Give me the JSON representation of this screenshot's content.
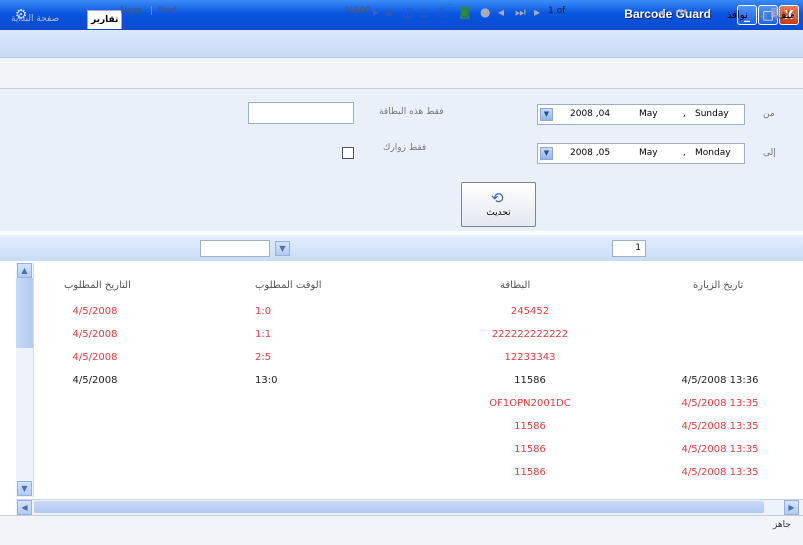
{
  "window": {
    "title": "Barcode Guard",
    "min": "_",
    "max": "□",
    "close": "X"
  },
  "menu": {
    "file": "ملف",
    "windows": "نوافذ"
  },
  "tabs": {
    "reports": "تقارير",
    "home": "صفحة البداية",
    "nav": "◁ ▷ X"
  },
  "filter": {
    "from_label": "من",
    "to_label": "إلى",
    "from_date": {
      "day": "Sunday",
      "month": "May",
      "date": "2008 ,04"
    },
    "to_date": {
      "day": "Monday",
      "month": "May",
      "date": "2008 ,05"
    },
    "card_only_label": "فقط هذه البطاقة",
    "my_visitors_label": "فقط زوارك",
    "card_value": "",
    "refresh_label": "تحديث"
  },
  "toolbar": {
    "find_next": "Next",
    "find": "Find",
    "zoom": "%100",
    "page_of": "1 of",
    "page_num": "1"
  },
  "report": {
    "columns": {
      "visit_date": "تاريخ الزيارة",
      "card": "البطاقة",
      "required_time": "الوقت المطلوب",
      "required_date": "التاريخ المطلوب"
    },
    "rows": [
      {
        "visit_date": "",
        "card": "245452",
        "required_time": "1:0",
        "required_date": "4/5/2008",
        "color": "red"
      },
      {
        "visit_date": "",
        "card": "222222222222",
        "required_time": "1:1",
        "required_date": "4/5/2008",
        "color": "red"
      },
      {
        "visit_date": "",
        "card": "12233343",
        "required_time": "2:5",
        "required_date": "4/5/2008",
        "color": "red"
      },
      {
        "visit_date": "4/5/2008 13:36",
        "card": "11586",
        "required_time": "13:0",
        "required_date": "4/5/2008",
        "color": "black"
      },
      {
        "visit_date": "4/5/2008 13:35",
        "card": "OF1OPN2001DC",
        "required_time": "",
        "required_date": "",
        "color": "red"
      },
      {
        "visit_date": "4/5/2008 13:35",
        "card": "11586",
        "required_time": "",
        "required_date": "",
        "color": "red"
      },
      {
        "visit_date": "4/5/2008 13:35",
        "card": "11586",
        "required_time": "",
        "required_date": "",
        "color": "red"
      },
      {
        "visit_date": "4/5/2008 13:35",
        "card": "11586",
        "required_time": "",
        "required_date": "",
        "color": "red"
      }
    ]
  },
  "status": {
    "text": "جاهز"
  },
  "colors": {
    "title_blue": "#0a55e0",
    "row_red": "#e03c3c"
  }
}
